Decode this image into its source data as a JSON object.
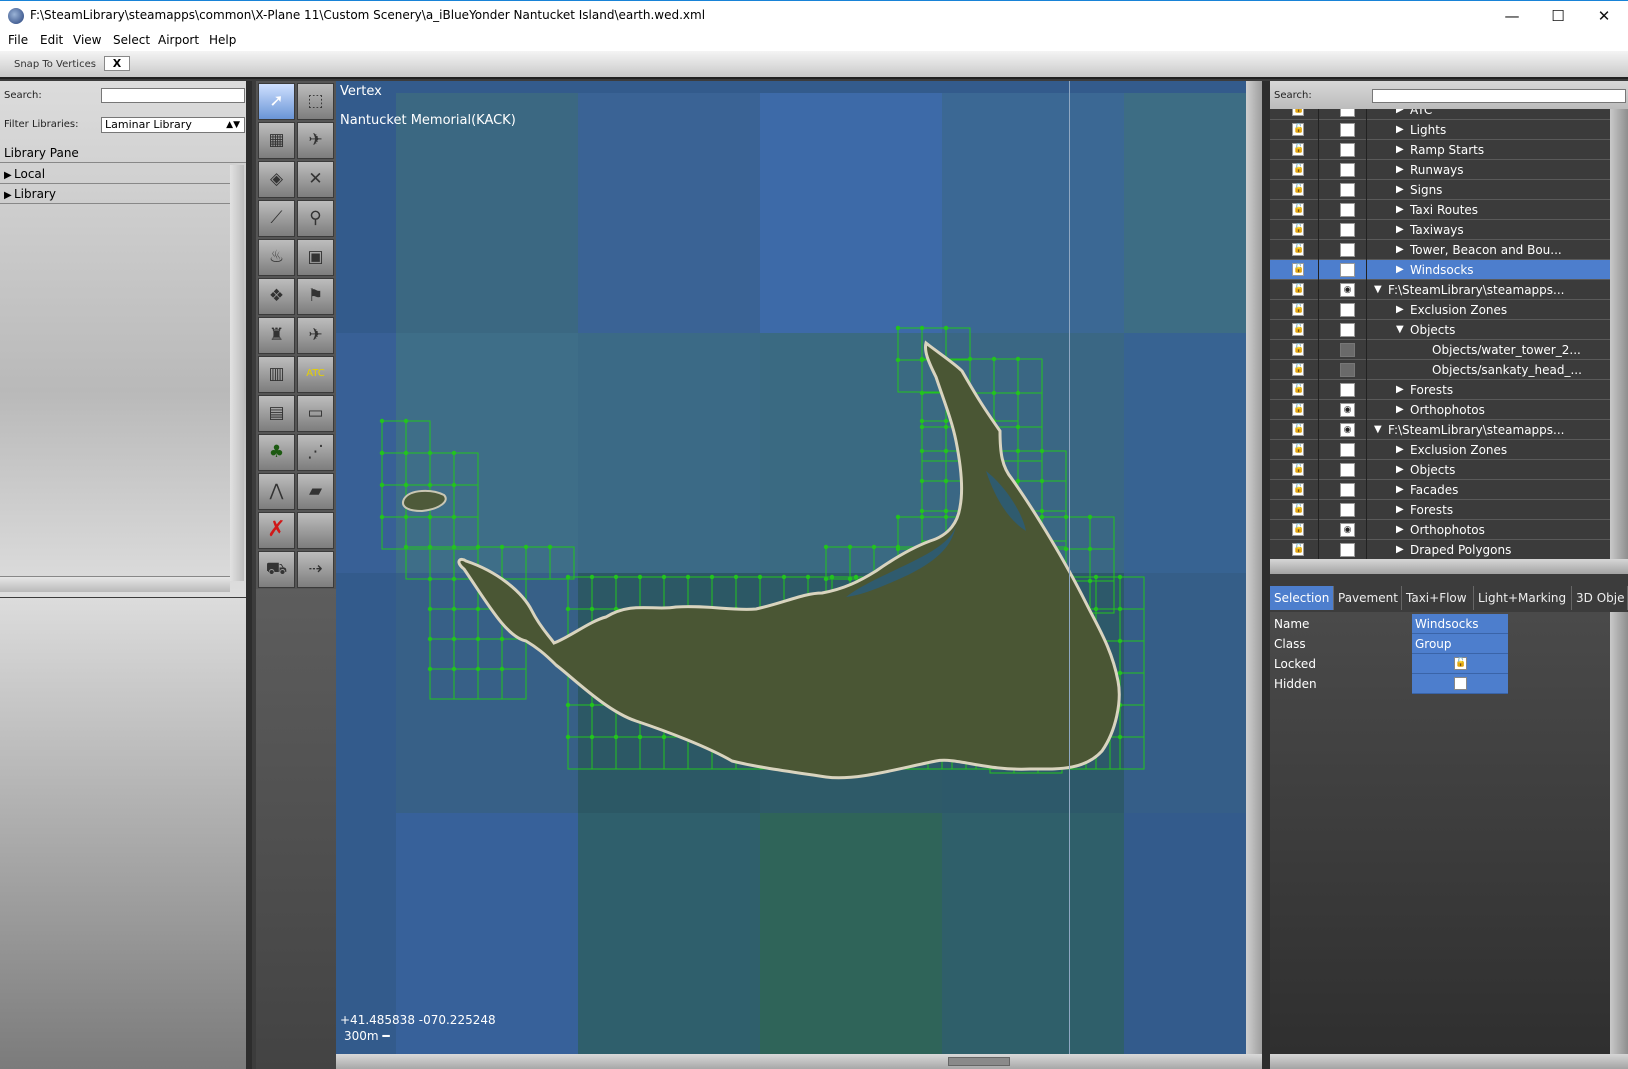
{
  "window": {
    "title": "F:\\SteamLibrary\\steamapps\\common\\X-Plane 11\\Custom Scenery\\a_iBlueYonder Nantucket Island\\earth.wed.xml",
    "minimize": "—",
    "maximize": "☐",
    "close": "✕"
  },
  "menu": [
    "File",
    "Edit",
    "View",
    "Select",
    "Airport",
    "Help"
  ],
  "toolbar": {
    "snap_label": "Snap To Vertices",
    "snap_value": "X"
  },
  "library": {
    "search_label": "Search:",
    "filter_label": "Filter Libraries:",
    "filter_value": "Laminar Library",
    "header": "Library Pane",
    "items": [
      "Local",
      "Library"
    ]
  },
  "map": {
    "mode": "Vertex",
    "airport": "Nantucket Memorial(KACK)",
    "coordinates": "+41.485838 -070.225248",
    "scale": "300m"
  },
  "tools": [
    {
      "name": "select-arrow-tool",
      "glyph": "➚"
    },
    {
      "name": "marquee-tool",
      "glyph": "⬚"
    },
    {
      "name": "runway-tool",
      "glyph": "▦"
    },
    {
      "name": "helipad-tool",
      "glyph": "✈"
    },
    {
      "name": "sealane-tool",
      "glyph": "◈"
    },
    {
      "name": "taxiway-tool",
      "glyph": "✕"
    },
    {
      "name": "taxiline-tool",
      "glyph": "⟋"
    },
    {
      "name": "boundary-tool",
      "glyph": "⚲"
    },
    {
      "name": "light-tool",
      "glyph": "♨"
    },
    {
      "name": "sign-tool",
      "glyph": "▣"
    },
    {
      "name": "object-tool",
      "glyph": "❖"
    },
    {
      "name": "windsock-tool",
      "glyph": "⚑"
    },
    {
      "name": "tower-tool",
      "glyph": "♜"
    },
    {
      "name": "ramp-start-tool",
      "glyph": "✈"
    },
    {
      "name": "facade-tool",
      "glyph": "▥"
    },
    {
      "name": "atc-tool",
      "glyph": "ATC"
    },
    {
      "name": "building-tool",
      "glyph": "▤"
    },
    {
      "name": "line-tool",
      "glyph": "▭"
    },
    {
      "name": "forest-tool",
      "glyph": "♣"
    },
    {
      "name": "string-tool",
      "glyph": "⋰"
    },
    {
      "name": "polygon-line-tool",
      "glyph": "⋀"
    },
    {
      "name": "draped-polygon-tool",
      "glyph": "▰"
    },
    {
      "name": "exclusion-tool",
      "glyph": "✗"
    },
    {
      "name": "blank-tool",
      "glyph": ""
    },
    {
      "name": "truck-tool",
      "glyph": "⛟"
    },
    {
      "name": "route-tool",
      "glyph": "⇢"
    }
  ],
  "layers": {
    "search_label": "Search:",
    "rows": [
      {
        "name": "ATC",
        "indent": 2,
        "triangle": "▶",
        "visible": false,
        "dim": false
      },
      {
        "name": "Lights",
        "indent": 2,
        "triangle": "▶",
        "visible": false,
        "dim": false
      },
      {
        "name": "Ramp Starts",
        "indent": 2,
        "triangle": "▶",
        "visible": false,
        "dim": false
      },
      {
        "name": "Runways",
        "indent": 2,
        "triangle": "▶",
        "visible": false,
        "dim": false
      },
      {
        "name": "Signs",
        "indent": 2,
        "triangle": "▶",
        "visible": false,
        "dim": false
      },
      {
        "name": "Taxi Routes",
        "indent": 2,
        "triangle": "▶",
        "visible": false,
        "dim": false
      },
      {
        "name": "Taxiways",
        "indent": 2,
        "triangle": "▶",
        "visible": false,
        "dim": false
      },
      {
        "name": "Tower, Beacon and Bou...",
        "indent": 2,
        "triangle": "▶",
        "visible": false,
        "dim": false
      },
      {
        "name": "Windsocks",
        "indent": 2,
        "triangle": "▶",
        "visible": false,
        "dim": false,
        "selected": true
      },
      {
        "name": "F:\\SteamLibrary\\steamapps...",
        "indent": 1,
        "triangle": "▼",
        "visible": true,
        "dim": false
      },
      {
        "name": "Exclusion Zones",
        "indent": 2,
        "triangle": "▶",
        "visible": false,
        "dim": false
      },
      {
        "name": "Objects",
        "indent": 2,
        "triangle": "▼",
        "visible": false,
        "dim": false
      },
      {
        "name": "Objects/water_tower_2...",
        "indent": 3,
        "triangle": "",
        "visible": false,
        "dim": true
      },
      {
        "name": "Objects/sankaty_head_...",
        "indent": 3,
        "triangle": "",
        "visible": false,
        "dim": true
      },
      {
        "name": "Forests",
        "indent": 2,
        "triangle": "▶",
        "visible": false,
        "dim": false
      },
      {
        "name": "Orthophotos",
        "indent": 2,
        "triangle": "▶",
        "visible": true,
        "dim": false
      },
      {
        "name": "F:\\SteamLibrary\\steamapps...",
        "indent": 1,
        "triangle": "▼",
        "visible": true,
        "dim": false
      },
      {
        "name": "Exclusion Zones",
        "indent": 2,
        "triangle": "▶",
        "visible": false,
        "dim": false
      },
      {
        "name": "Objects",
        "indent": 2,
        "triangle": "▶",
        "visible": false,
        "dim": false
      },
      {
        "name": "Facades",
        "indent": 2,
        "triangle": "▶",
        "visible": false,
        "dim": false
      },
      {
        "name": "Forests",
        "indent": 2,
        "triangle": "▶",
        "visible": false,
        "dim": false
      },
      {
        "name": "Orthophotos",
        "indent": 2,
        "triangle": "▶",
        "visible": true,
        "dim": false
      },
      {
        "name": "Draped Polygons",
        "indent": 2,
        "triangle": "▶",
        "visible": false,
        "dim": false
      }
    ]
  },
  "tabs": [
    "Selection",
    "Pavement",
    "Taxi+Flow",
    "Light+Marking",
    "3D Obje"
  ],
  "properties": [
    {
      "key": "Name",
      "value": "Windsocks",
      "type": "text"
    },
    {
      "key": "Class",
      "value": "Group",
      "type": "text"
    },
    {
      "key": "Locked",
      "value": "",
      "type": "lock"
    },
    {
      "key": "Hidden",
      "value": "",
      "type": "check"
    }
  ],
  "colors": {
    "selection": "#4d7ecd",
    "grid": "#22c41e",
    "map": "#335b8c"
  }
}
